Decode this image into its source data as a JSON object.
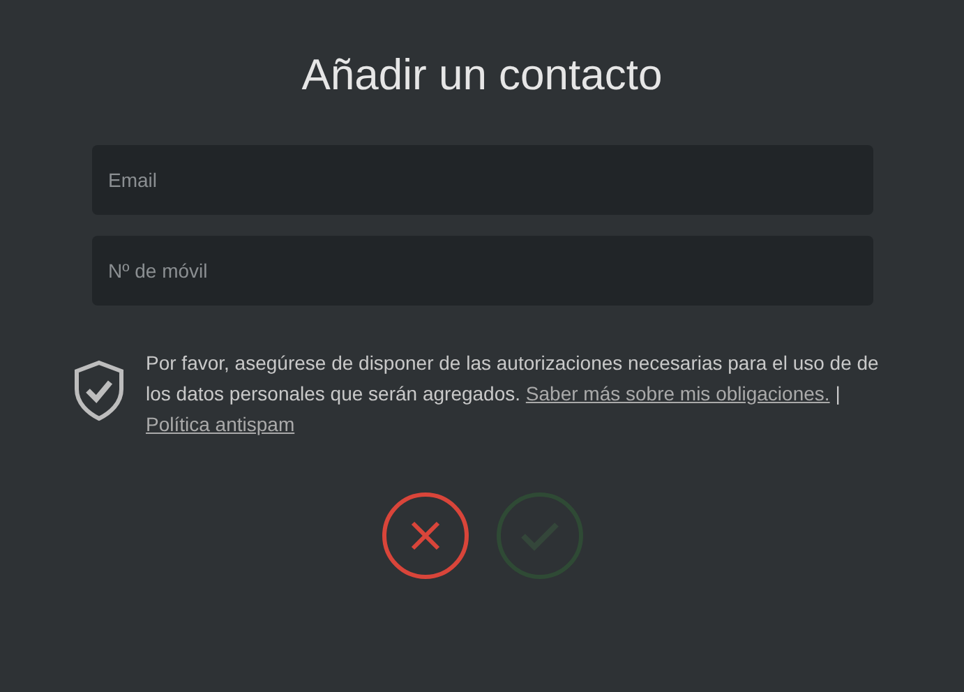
{
  "title": "Añadir un contacto",
  "fields": [
    {
      "placeholder": "Email"
    },
    {
      "placeholder": "Nº de móvil"
    }
  ],
  "notice": {
    "text": "Por favor, asegúrese de disponer de las autorizaciones necesarias para el uso de de los datos personales que serán agregados.",
    "links": [
      "Saber más sobre mis obligaciones.",
      "Política antispam"
    ],
    "separator": "|"
  },
  "buttons": [
    {
      "kind": "cancel",
      "disabled": false
    },
    {
      "kind": "confirm",
      "disabled": true
    }
  ]
}
